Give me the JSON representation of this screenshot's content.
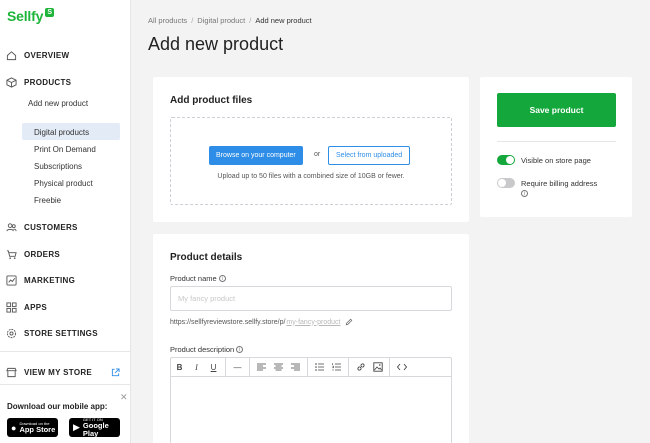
{
  "brand": {
    "name": "Sellfy",
    "badge": "S",
    "accent": "#1eb53a"
  },
  "sidebar": {
    "nav": {
      "overview": "OVERVIEW",
      "products": "PRODUCTS",
      "customers": "CUSTOMERS",
      "orders": "ORDERS",
      "marketing": "MARKETING",
      "apps": "APPS",
      "store_settings": "STORE SETTINGS",
      "view_my_store": "VIEW MY STORE"
    },
    "products_sub": {
      "add_new": "Add new product",
      "items": [
        "Digital products",
        "Print On Demand",
        "Subscriptions",
        "Physical product",
        "Freebie"
      ],
      "active": "Digital products"
    },
    "mobile_app": {
      "title": "Download our mobile app:",
      "app_store_small": "Download on the",
      "app_store_big": "App Store",
      "google_play_small": "GET IT ON",
      "google_play_big": "Google Play"
    }
  },
  "breadcrumb": [
    "All products",
    "Digital product",
    "Add new product"
  ],
  "page_title": "Add new product",
  "files_card": {
    "title": "Add product files",
    "browse_button": "Browse on your computer",
    "or": "or",
    "select_uploaded_button": "Select from uploaded",
    "hint": "Upload up to 50 files with a combined size of 10GB or fewer."
  },
  "details_card": {
    "title": "Product details",
    "name_label": "Product name",
    "name_placeholder": "My fancy product",
    "url_prefix": "https://sellfyreviewstore.sellfy.store/p/",
    "url_slug": "my-fancy-product",
    "description_label": "Product description"
  },
  "publish_card": {
    "save_button": "Save product",
    "visible_label": "Visible on store page",
    "visible_on": true,
    "billing_label": "Require billing address",
    "billing_on": false
  }
}
